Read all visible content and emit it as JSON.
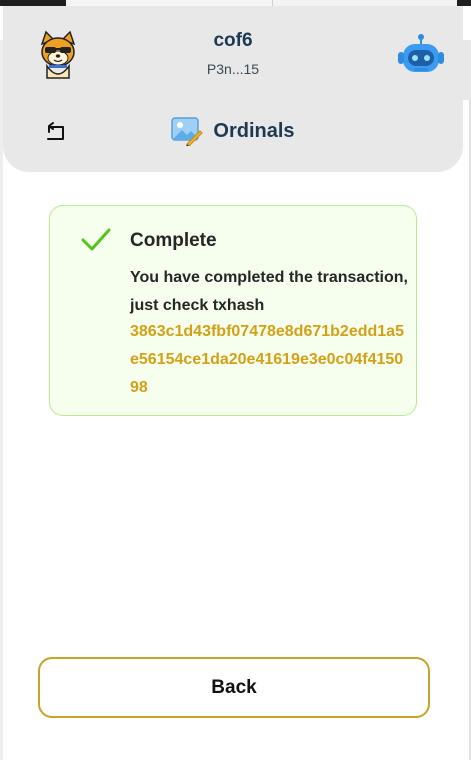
{
  "header": {
    "account_name": "cof6",
    "account_address": "P3n...15",
    "avatar_icon": "shiba-dog-avatar-icon",
    "robot_icon": "robot-icon",
    "back_icon": "return-arrow-icon"
  },
  "page": {
    "title": "Ordinals",
    "title_icon": "image-pencil-icon"
  },
  "result": {
    "status_icon": "checkmark-icon",
    "title": "Complete",
    "message": "You have completed the transaction, just check txhash",
    "txhash": "3863c1d43fbf07478e8d671b2edd1a5e56154ce1da20e41619e3e0c04f415098"
  },
  "actions": {
    "back_label": "Back"
  },
  "colors": {
    "header_bg": "#e8e8e8",
    "card_bg": "#f6ffed",
    "card_border": "#b7eb8f",
    "check_green": "#52c41a",
    "hash_gold": "#d4a017",
    "button_border": "#c9a227",
    "title_navy": "#1e3a52"
  }
}
